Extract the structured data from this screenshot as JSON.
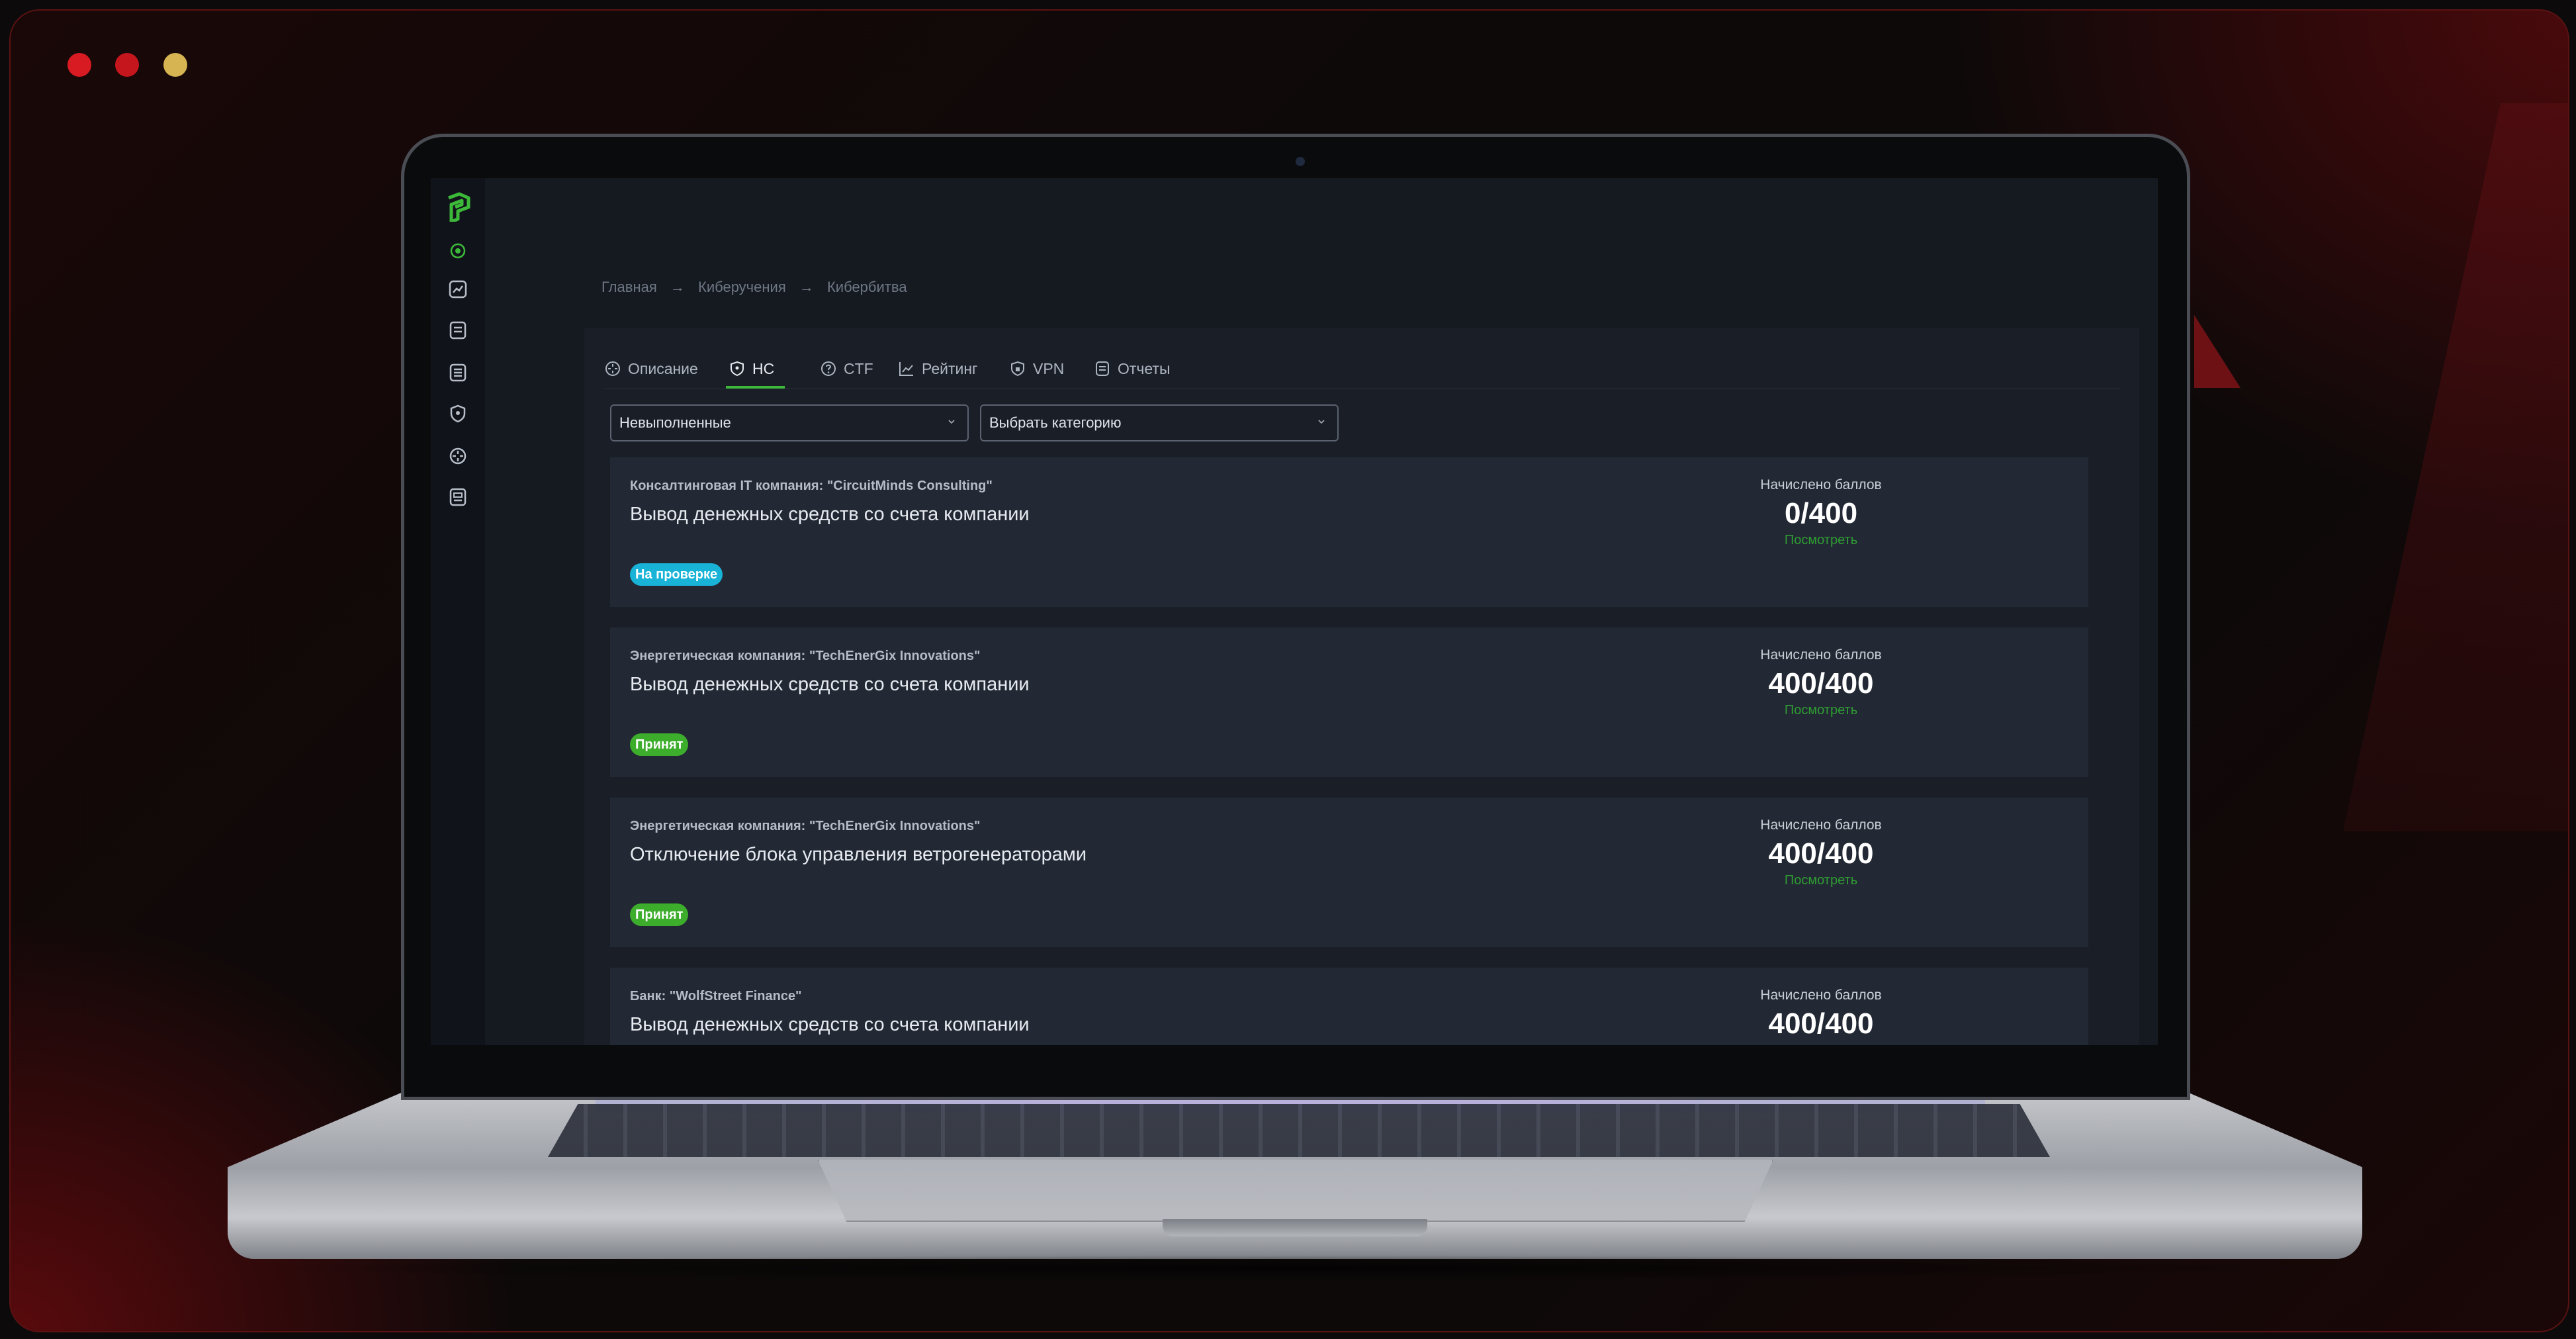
{
  "window_controls": {
    "close": "#d81b22",
    "minimize": "#c6161d",
    "maximize": "#d6b452"
  },
  "breadcrumb": [
    "Главная",
    "→",
    "Киберучения",
    "→",
    "Кибербитва"
  ],
  "tabs": [
    {
      "label": "Описание",
      "icon": "crosshair-icon"
    },
    {
      "label": "НС",
      "icon": "shield-icon",
      "active": true
    },
    {
      "label": "CTF",
      "icon": "question-circle-icon"
    },
    {
      "label": "Рейтинг",
      "icon": "chart-icon"
    },
    {
      "label": "VPN",
      "icon": "vpn-shield-icon"
    },
    {
      "label": "Отчеты",
      "icon": "document-icon"
    }
  ],
  "filters": {
    "status": "Невыполненные",
    "category": "Выбрать категорию"
  },
  "score_label": "Начислено баллов",
  "view_label": "Посмотреть",
  "cards": [
    {
      "category": "Консалтинговая IT компания: \"CircuitMinds Consulting\"",
      "title": "Вывод денежных средств со счета компании",
      "status": "На проверке",
      "score": "0/400"
    },
    {
      "category": "Энергетическая компания: \"TechEnerGix Innovations\"",
      "title": "Вывод денежных средств со счета компании",
      "status": "Принят",
      "score": "400/400"
    },
    {
      "category": "Энергетическая компания: \"TechEnerGix Innovations\"",
      "title": "Отключение блока управления ветрогенераторами",
      "status": "Принят",
      "score": "400/400"
    },
    {
      "category": "Банк: \"WolfStreet Finance\"",
      "title": "Вывод денежных средств со счета компании",
      "score": "400/400"
    }
  ],
  "colors": {
    "accent": "#3db93a",
    "review_badge": "#19b3d8",
    "accepted_badge": "#3cae2c"
  }
}
